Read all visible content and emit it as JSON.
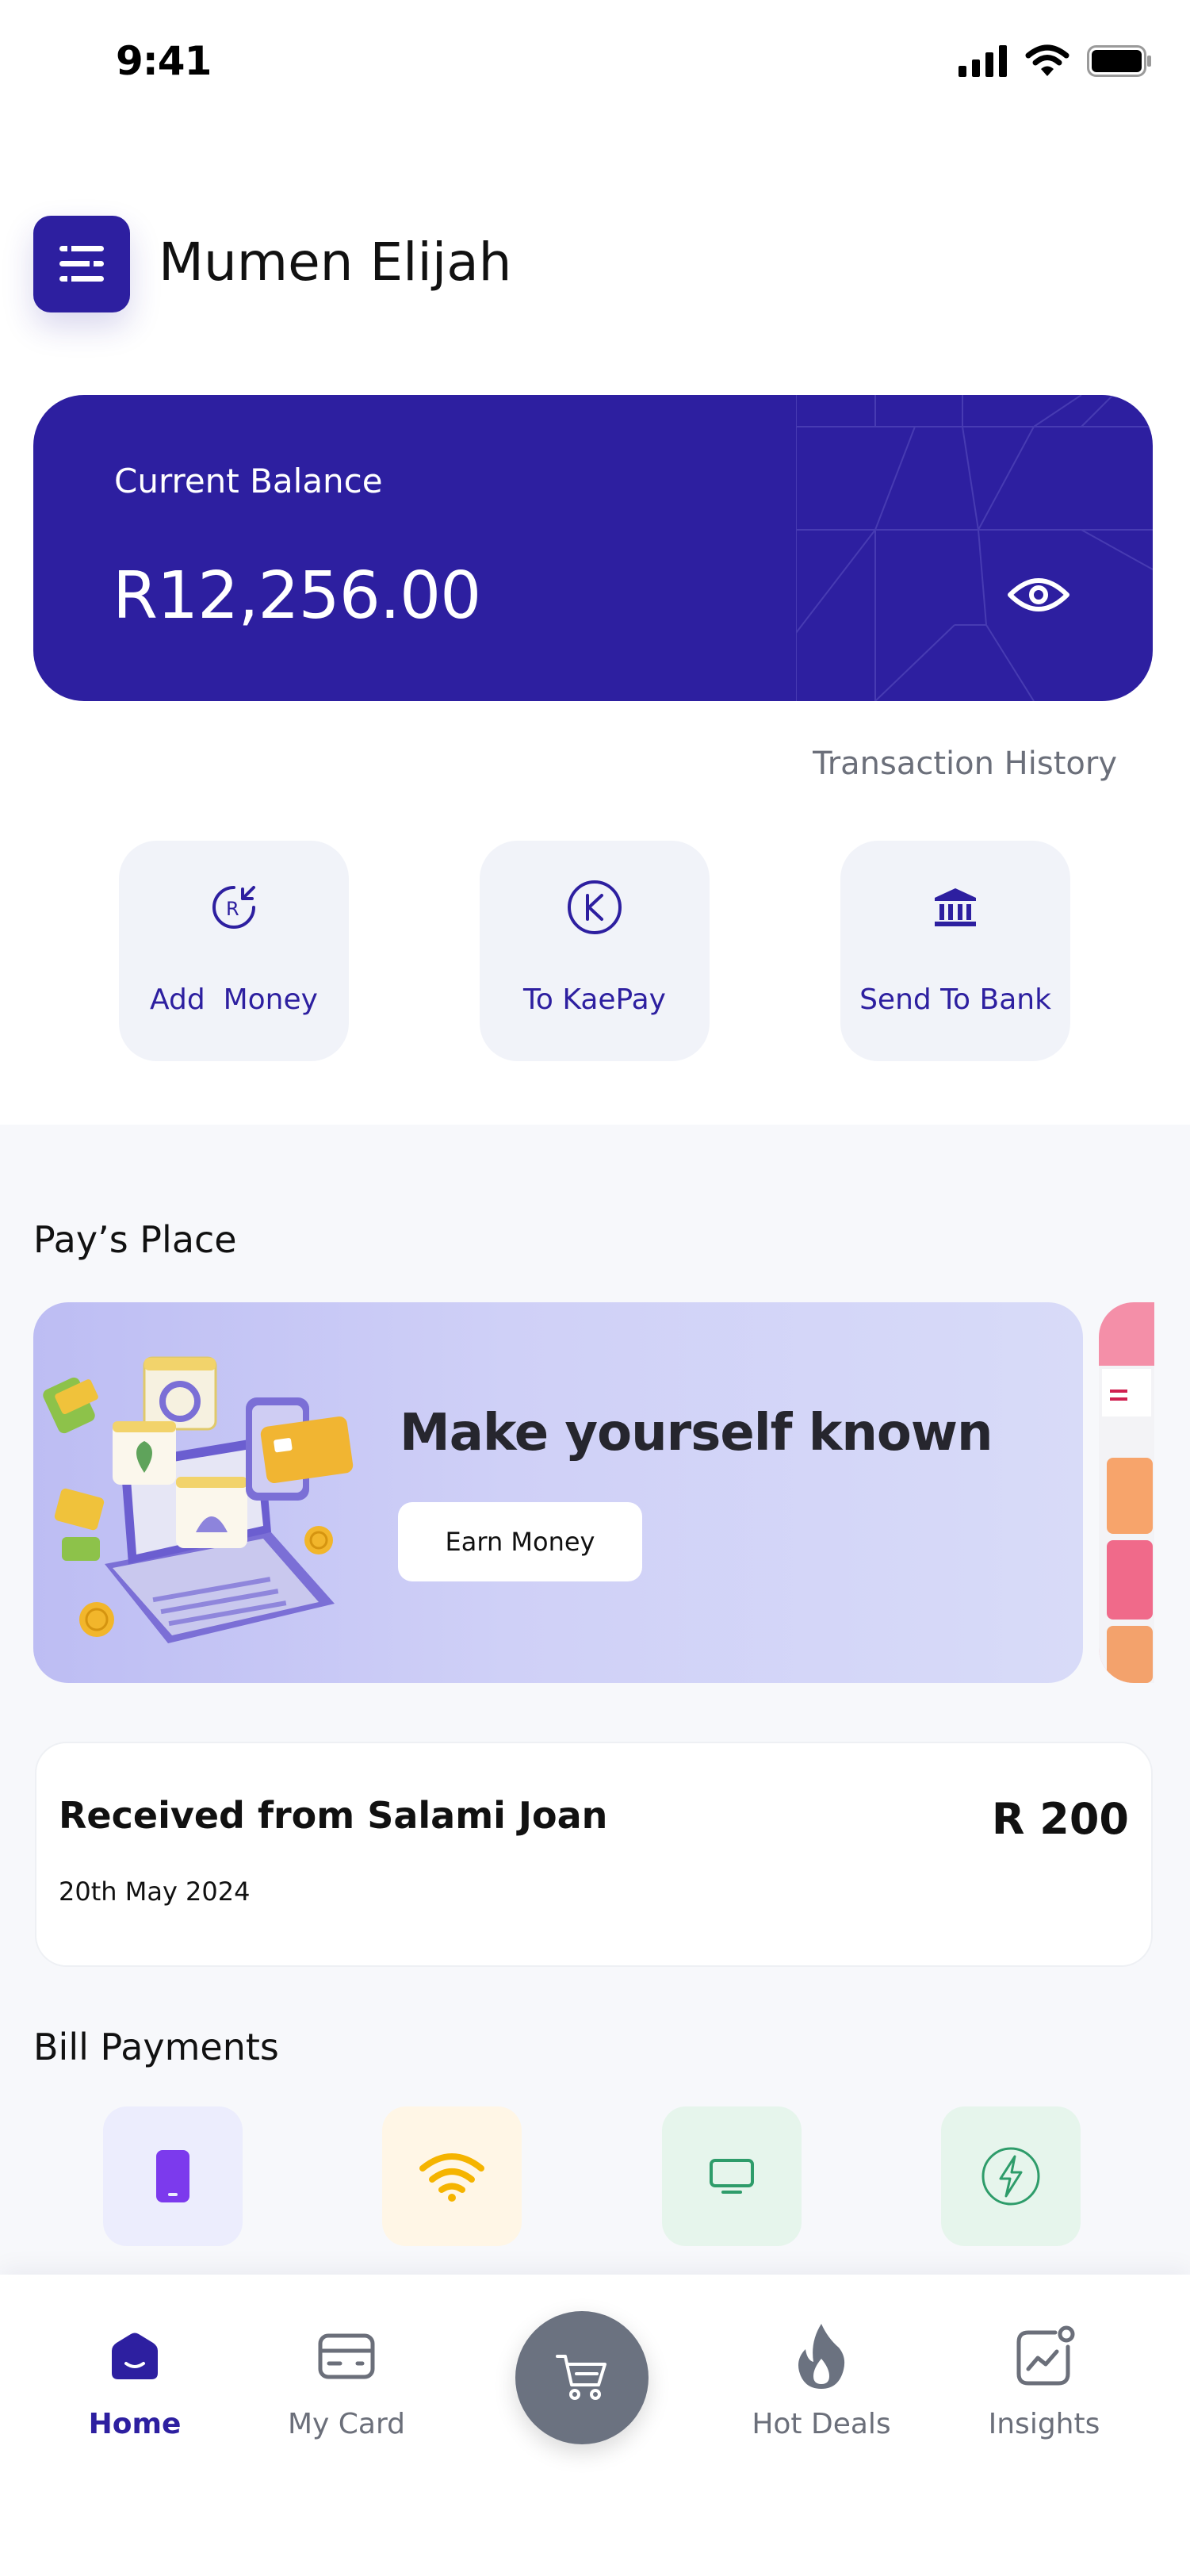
{
  "status_bar": {
    "time": "9:41"
  },
  "header": {
    "user_name": "Mumen Elijah",
    "menu_icon": "menu-icon"
  },
  "balance": {
    "label": "Current Balance",
    "amount": "R12,256.00",
    "toggle_icon": "eye-icon",
    "card_color": "#2d1fa0"
  },
  "transaction_history_label": "Transaction History",
  "quick_actions": [
    {
      "label": "Add  Money",
      "icon": "add-money-icon"
    },
    {
      "label": "To KaePay",
      "icon": "kaepay-icon"
    },
    {
      "label": "Send To Bank",
      "icon": "bank-icon"
    }
  ],
  "pays_place": {
    "title": "Pay’s Place",
    "banner_title": "Make yourself known",
    "banner_button": "Earn Money"
  },
  "recent_transaction": {
    "title": "Received from Salami Joan",
    "amount": "R 200",
    "date": "20th May 2024"
  },
  "bill_payments": {
    "title": "Bill Payments",
    "items": [
      {
        "icon": "phone-icon",
        "color": "#7c3aed",
        "bg": "#ecedfd"
      },
      {
        "icon": "wifi-icon",
        "color": "#f5b400",
        "bg": "#fff6e6"
      },
      {
        "icon": "tv-icon",
        "color": "#2e9c6a",
        "bg": "#e6f5ec"
      },
      {
        "icon": "electricity-icon",
        "color": "#2e9c6a",
        "bg": "#e6f5ec"
      }
    ]
  },
  "bottom_nav": {
    "items": [
      {
        "label": "Home",
        "icon": "home-icon",
        "active": true
      },
      {
        "label": "My Card",
        "icon": "card-icon",
        "active": false
      },
      {
        "label": "Hot Deals",
        "icon": "flame-icon",
        "active": false
      },
      {
        "label": "Insights",
        "icon": "insights-icon",
        "active": false
      }
    ],
    "center_icon": "cart-icon"
  },
  "colors": {
    "primary": "#2d1fa0",
    "muted": "#6b6f7a",
    "nav_fab": "#6b7280"
  }
}
